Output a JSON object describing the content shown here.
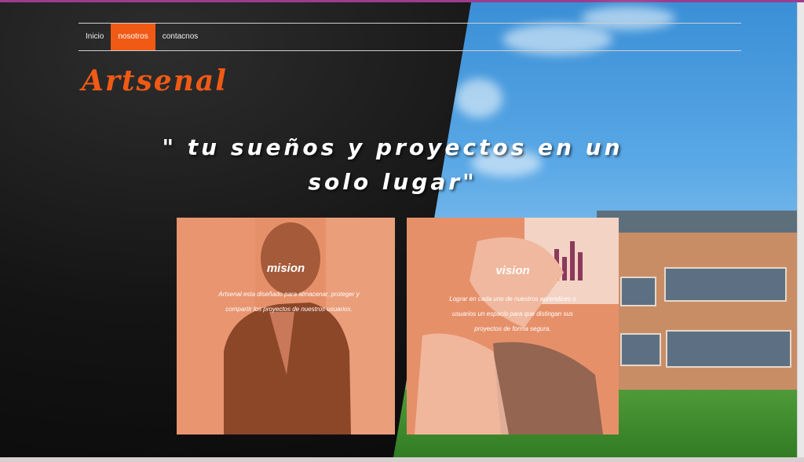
{
  "nav": {
    "items": [
      {
        "label": "Inicio",
        "active": false
      },
      {
        "label": "nosotros",
        "active": true
      },
      {
        "label": "contacnos",
        "active": false
      }
    ]
  },
  "brand": {
    "name": "Artsenal"
  },
  "hero": {
    "slogan_line1": "\" tu sueños y proyectos en un",
    "slogan_line2": "solo lugar\""
  },
  "cards": {
    "mision": {
      "title": "mision",
      "text": "Artsenal esta diseñado para almacenar, proteger y compartir los proyectos de nuestros usuarios."
    },
    "vision": {
      "title": "vision",
      "text": "Lograr en cada uno de nuestros aprendices o usuarios un espacio para que distingan sus proyectos de forma segura."
    }
  },
  "colors": {
    "accent": "#f05a15",
    "card": "#e6906a",
    "top_strip": "#9b3d8e"
  }
}
